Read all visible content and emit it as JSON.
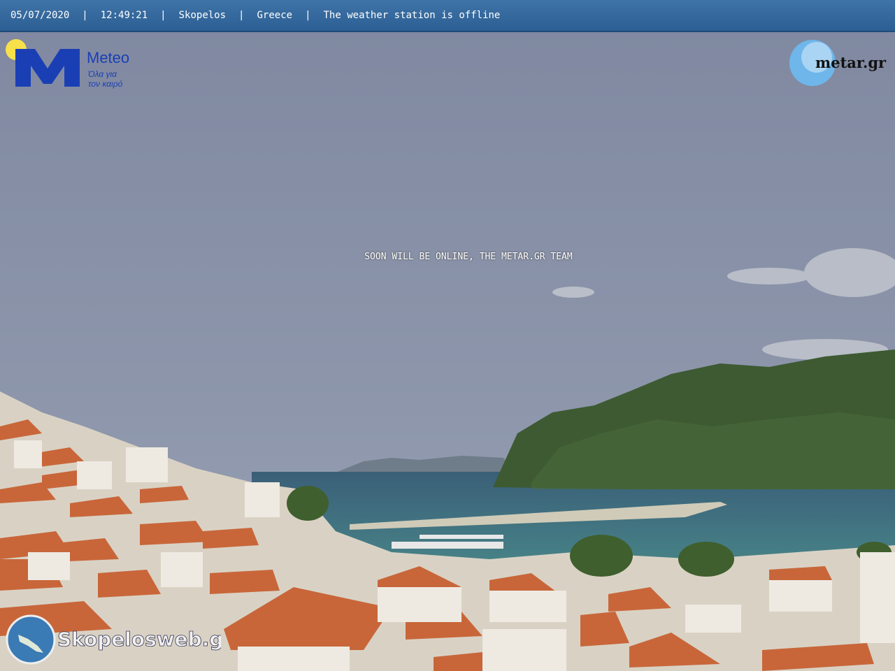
{
  "topbar": {
    "date": "05/07/2020",
    "time": "12:49:21",
    "location": "Skopelos",
    "country": "Greece",
    "status": "The weather station is offline",
    "separator": "|"
  },
  "overlay": {
    "message": "SOON WILL BE ONLINE, THE METAR.GR TEAM"
  },
  "logos": {
    "meteo": {
      "name": "Meteo",
      "tagline_1": "Όλα για",
      "tagline_2": "τον καιρό"
    },
    "metar": {
      "name": "metar.gr"
    },
    "skopelosweb": {
      "name": "Skopelosweb.gr"
    }
  },
  "colors": {
    "topbar": "#2c5f93",
    "sky": "#8a93a8",
    "sea": "#3f7f8a",
    "hill": "#3d5a32",
    "roof": "#c8663a"
  }
}
